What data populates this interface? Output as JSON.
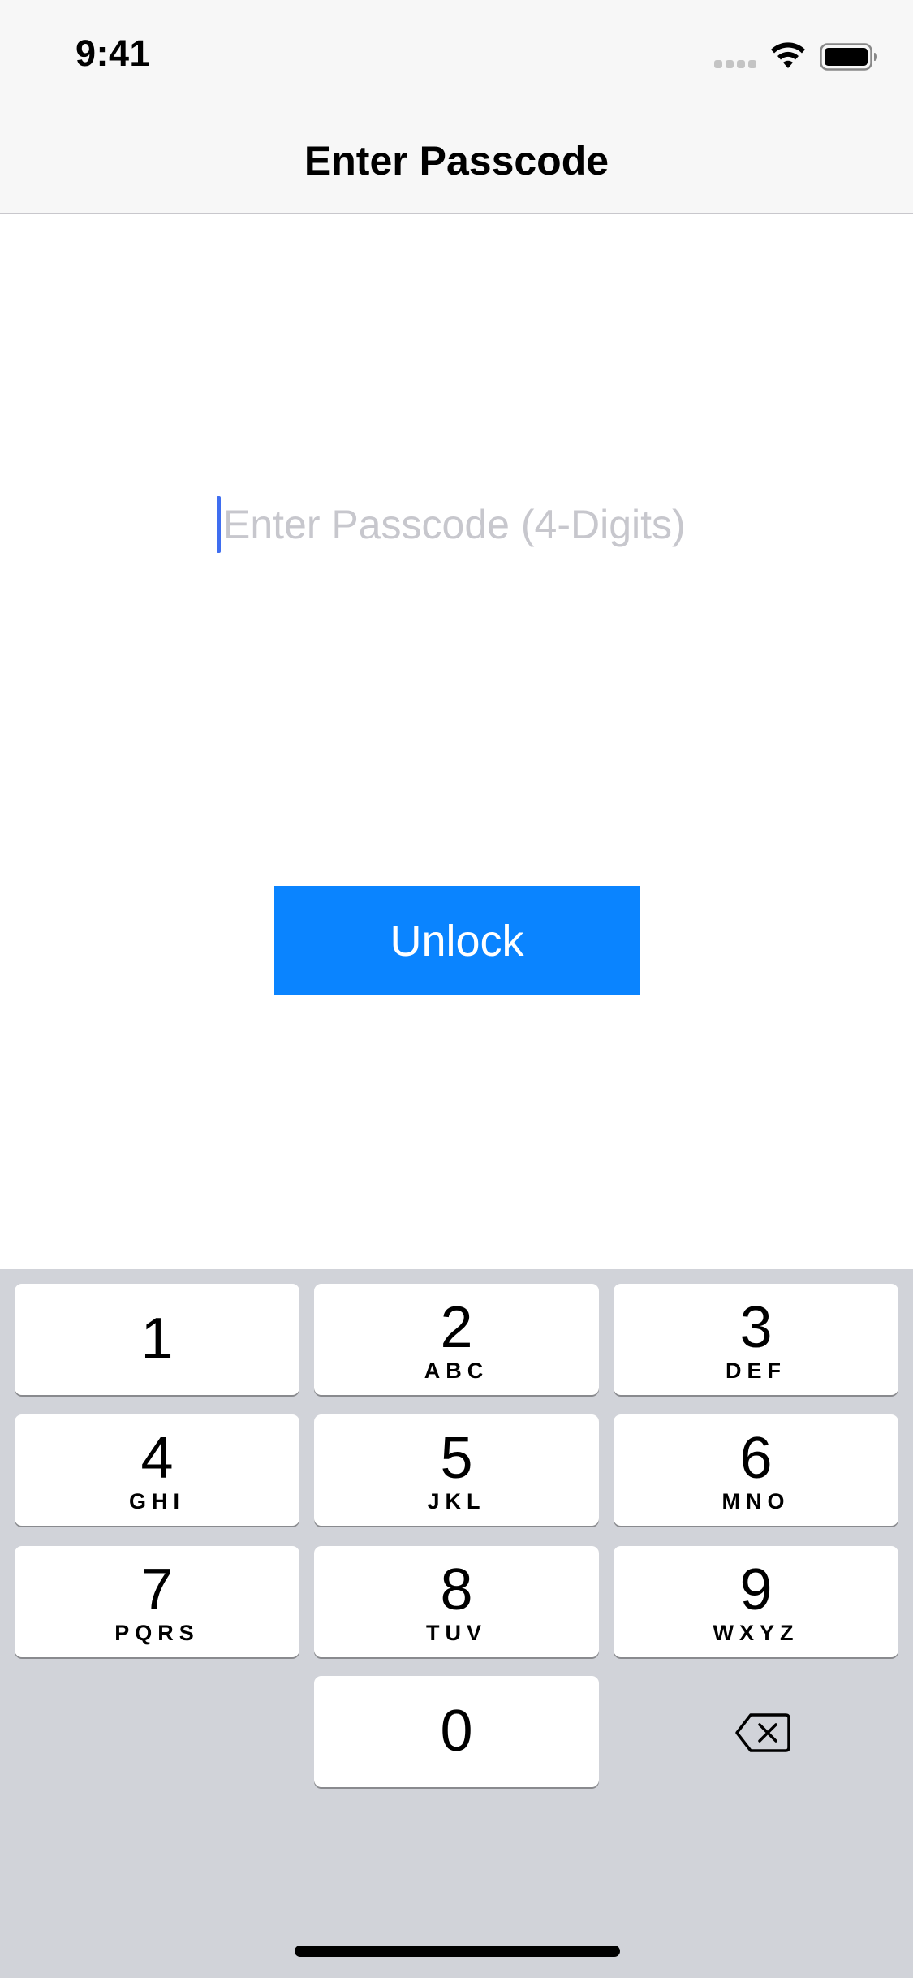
{
  "status_bar": {
    "time": "9:41"
  },
  "nav": {
    "title": "Enter Passcode"
  },
  "passcode": {
    "value": "",
    "placeholder": "Enter Passcode (4-Digits)"
  },
  "unlock_button": {
    "label": "Unlock",
    "color": "#0a84ff"
  },
  "keypad": {
    "keys": [
      {
        "digit": "1",
        "letters": ""
      },
      {
        "digit": "2",
        "letters": "ABC"
      },
      {
        "digit": "3",
        "letters": "DEF"
      },
      {
        "digit": "4",
        "letters": "GHI"
      },
      {
        "digit": "5",
        "letters": "JKL"
      },
      {
        "digit": "6",
        "letters": "MNO"
      },
      {
        "digit": "7",
        "letters": "PQRS"
      },
      {
        "digit": "8",
        "letters": "TUV"
      },
      {
        "digit": "9",
        "letters": "WXYZ"
      },
      {
        "digit": "0",
        "letters": ""
      }
    ],
    "delete_icon": "delete-backspace-icon",
    "background": "#d1d3d9"
  }
}
